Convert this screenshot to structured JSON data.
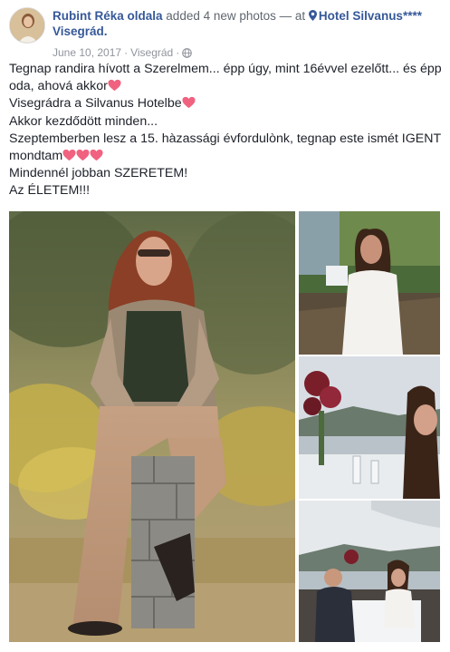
{
  "post": {
    "author": "Rubint Réka oldala",
    "action": "added 4 new photos — at",
    "place": "Hotel Silvanus**** Visegrád.",
    "place_icon": "map-pin-icon",
    "date": "June 10, 2017",
    "location": "Visegrád",
    "audience_icon": "globe-icon",
    "lines": [
      "Tegnap randira hívott a Szerelmem... épp úgy, mint 16évvel ezelőtt... és épp",
      "oda, ahová akkor",
      "Visegrádra a Silvanus Hotelbe",
      "Akkor kezdődött minden...",
      "Szeptemberben lesz a 15. hàzassági évfordulònk, tegnap este ismét IGENT",
      "mondtam",
      "Mindennél jobban SZERETEM!",
      "Az ÉLETEM!!!"
    ],
    "heart_color": "#f0627f",
    "link_color": "#365899"
  },
  "photos": [
    {
      "name": "main",
      "description_icon": "photo-woman-sitting-on-stone-post"
    },
    {
      "name": "1",
      "description_icon": "photo-woman-white-dress"
    },
    {
      "name": "2",
      "description_icon": "photo-table-flowers-lake"
    },
    {
      "name": "3",
      "description_icon": "photo-couple-dinner-terrace"
    }
  ]
}
